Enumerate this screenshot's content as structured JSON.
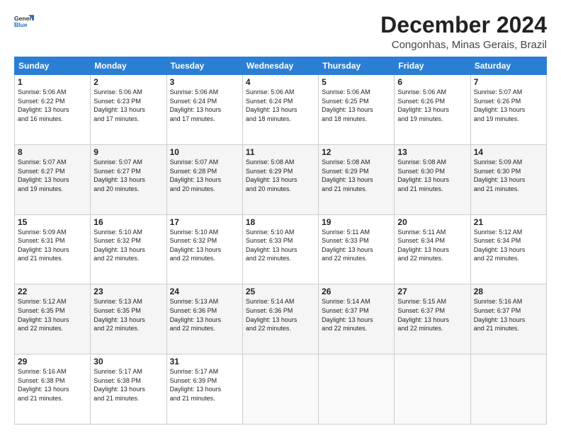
{
  "header": {
    "logo_line1": "General",
    "logo_line2": "Blue",
    "title": "December 2024",
    "subtitle": "Congonhas, Minas Gerais, Brazil"
  },
  "columns": [
    "Sunday",
    "Monday",
    "Tuesday",
    "Wednesday",
    "Thursday",
    "Friday",
    "Saturday"
  ],
  "weeks": [
    [
      {
        "day": "1",
        "sunrise": "5:06 AM",
        "sunset": "6:22 PM",
        "daylight": "13 hours and 16 minutes."
      },
      {
        "day": "2",
        "sunrise": "5:06 AM",
        "sunset": "6:23 PM",
        "daylight": "13 hours and 17 minutes."
      },
      {
        "day": "3",
        "sunrise": "5:06 AM",
        "sunset": "6:24 PM",
        "daylight": "13 hours and 17 minutes."
      },
      {
        "day": "4",
        "sunrise": "5:06 AM",
        "sunset": "6:24 PM",
        "daylight": "13 hours and 18 minutes."
      },
      {
        "day": "5",
        "sunrise": "5:06 AM",
        "sunset": "6:25 PM",
        "daylight": "13 hours and 18 minutes."
      },
      {
        "day": "6",
        "sunrise": "5:06 AM",
        "sunset": "6:26 PM",
        "daylight": "13 hours and 19 minutes."
      },
      {
        "day": "7",
        "sunrise": "5:07 AM",
        "sunset": "6:26 PM",
        "daylight": "13 hours and 19 minutes."
      }
    ],
    [
      {
        "day": "8",
        "sunrise": "5:07 AM",
        "sunset": "6:27 PM",
        "daylight": "13 hours and 19 minutes."
      },
      {
        "day": "9",
        "sunrise": "5:07 AM",
        "sunset": "6:27 PM",
        "daylight": "13 hours and 20 minutes."
      },
      {
        "day": "10",
        "sunrise": "5:07 AM",
        "sunset": "6:28 PM",
        "daylight": "13 hours and 20 minutes."
      },
      {
        "day": "11",
        "sunrise": "5:08 AM",
        "sunset": "6:29 PM",
        "daylight": "13 hours and 20 minutes."
      },
      {
        "day": "12",
        "sunrise": "5:08 AM",
        "sunset": "6:29 PM",
        "daylight": "13 hours and 21 minutes."
      },
      {
        "day": "13",
        "sunrise": "5:08 AM",
        "sunset": "6:30 PM",
        "daylight": "13 hours and 21 minutes."
      },
      {
        "day": "14",
        "sunrise": "5:09 AM",
        "sunset": "6:30 PM",
        "daylight": "13 hours and 21 minutes."
      }
    ],
    [
      {
        "day": "15",
        "sunrise": "5:09 AM",
        "sunset": "6:31 PM",
        "daylight": "13 hours and 21 minutes."
      },
      {
        "day": "16",
        "sunrise": "5:10 AM",
        "sunset": "6:32 PM",
        "daylight": "13 hours and 22 minutes."
      },
      {
        "day": "17",
        "sunrise": "5:10 AM",
        "sunset": "6:32 PM",
        "daylight": "13 hours and 22 minutes."
      },
      {
        "day": "18",
        "sunrise": "5:10 AM",
        "sunset": "6:33 PM",
        "daylight": "13 hours and 22 minutes."
      },
      {
        "day": "19",
        "sunrise": "5:11 AM",
        "sunset": "6:33 PM",
        "daylight": "13 hours and 22 minutes."
      },
      {
        "day": "20",
        "sunrise": "5:11 AM",
        "sunset": "6:34 PM",
        "daylight": "13 hours and 22 minutes."
      },
      {
        "day": "21",
        "sunrise": "5:12 AM",
        "sunset": "6:34 PM",
        "daylight": "13 hours and 22 minutes."
      }
    ],
    [
      {
        "day": "22",
        "sunrise": "5:12 AM",
        "sunset": "6:35 PM",
        "daylight": "13 hours and 22 minutes."
      },
      {
        "day": "23",
        "sunrise": "5:13 AM",
        "sunset": "6:35 PM",
        "daylight": "13 hours and 22 minutes."
      },
      {
        "day": "24",
        "sunrise": "5:13 AM",
        "sunset": "6:36 PM",
        "daylight": "13 hours and 22 minutes."
      },
      {
        "day": "25",
        "sunrise": "5:14 AM",
        "sunset": "6:36 PM",
        "daylight": "13 hours and 22 minutes."
      },
      {
        "day": "26",
        "sunrise": "5:14 AM",
        "sunset": "6:37 PM",
        "daylight": "13 hours and 22 minutes."
      },
      {
        "day": "27",
        "sunrise": "5:15 AM",
        "sunset": "6:37 PM",
        "daylight": "13 hours and 22 minutes."
      },
      {
        "day": "28",
        "sunrise": "5:16 AM",
        "sunset": "6:37 PM",
        "daylight": "13 hours and 21 minutes."
      }
    ],
    [
      {
        "day": "29",
        "sunrise": "5:16 AM",
        "sunset": "6:38 PM",
        "daylight": "13 hours and 21 minutes."
      },
      {
        "day": "30",
        "sunrise": "5:17 AM",
        "sunset": "6:38 PM",
        "daylight": "13 hours and 21 minutes."
      },
      {
        "day": "31",
        "sunrise": "5:17 AM",
        "sunset": "6:39 PM",
        "daylight": "13 hours and 21 minutes."
      },
      null,
      null,
      null,
      null
    ]
  ],
  "daylight_label": "Daylight:",
  "sunrise_label": "Sunrise:",
  "sunset_label": "Sunset:"
}
